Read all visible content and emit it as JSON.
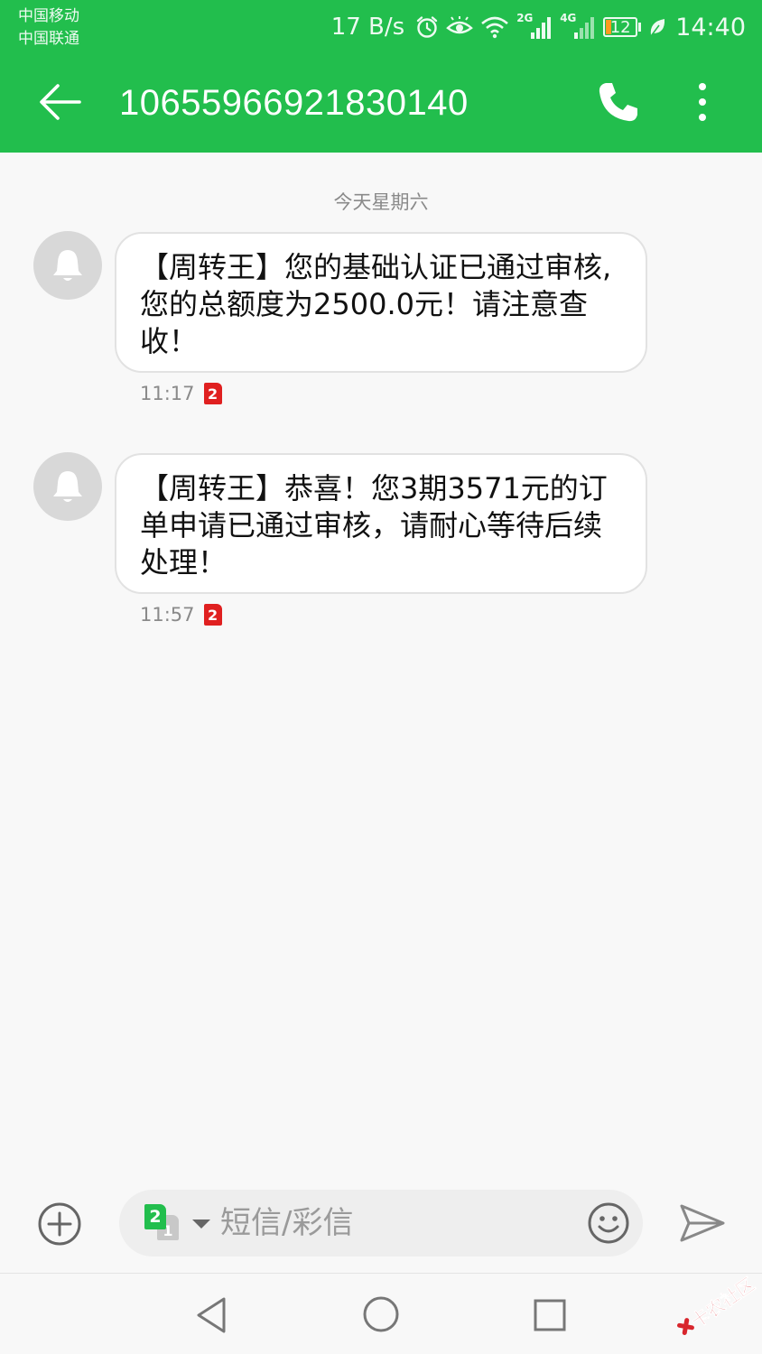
{
  "status_bar": {
    "carrier1": "中国移动",
    "carrier2": "中国联通",
    "net_speed": "17 B/s",
    "sim1_network": "2G",
    "sim2_network": "4G",
    "battery_level": "12",
    "time": "14:40",
    "icons": [
      "alarm-icon",
      "eye-comfort-icon",
      "wifi-icon",
      "signal-2g-icon",
      "signal-4g-icon",
      "battery-icon",
      "leaf-icon"
    ]
  },
  "app_bar": {
    "title": "10655966921830140",
    "icons": [
      "back-arrow-icon",
      "phone-icon",
      "more-vertical-icon"
    ],
    "color": "#22be4d"
  },
  "conversation": {
    "date_separator": "今天星期六",
    "messages": [
      {
        "text": "【周转王】您的基础认证已通过审核,您的总额度为2500.0元！请注意查收！",
        "time": "11:17",
        "sim": "2"
      },
      {
        "text": "【周转王】恭喜！您3期3571元的订单申请已通过审核，请耐心等待后续处理！",
        "time": "11:57",
        "sim": "2"
      }
    ]
  },
  "composer": {
    "placeholder": "短信/彩信",
    "sim_front": "2",
    "sim_back": "1",
    "icons": [
      "add-icon",
      "emoji-icon",
      "send-icon"
    ]
  },
  "nav_bar": {
    "icons": [
      "nav-back-icon",
      "nav-home-icon",
      "nav-recent-icon"
    ]
  },
  "watermark": {
    "text": "卡农社区"
  }
}
